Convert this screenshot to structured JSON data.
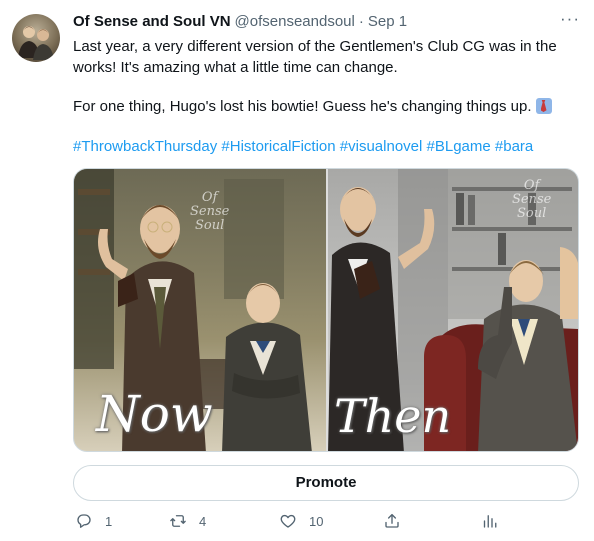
{
  "tweet": {
    "author_name": "Of Sense and Soul VN",
    "handle": "@ofsenseandsoul",
    "separator": "·",
    "date": "Sep 1",
    "more_label": "···",
    "text_line1": "Last year, a very different version of the Gentlemen's Club CG was in the works! It's amazing what a little time can change.",
    "text_line2": "For one thing, Hugo's lost his bowtie! Guess he's changing things up.",
    "emoji": "necktie-emoji",
    "hashtags": [
      "#ThrowbackThursday",
      "#HistoricalFiction",
      "#visualnovel",
      "#BLgame",
      "#bara"
    ]
  },
  "media": {
    "left_caption": "Now",
    "right_caption": "Then",
    "watermark_lines": [
      "Of",
      "Sense",
      "Soul"
    ]
  },
  "promote_label": "Promote",
  "actions": {
    "reply_count": "1",
    "retweet_count": "4",
    "like_count": "10",
    "icons": [
      "reply-icon",
      "retweet-icon",
      "like-icon",
      "share-icon",
      "analytics-icon"
    ]
  },
  "colors": {
    "link": "#1d9bf0",
    "secondary_text": "#536471",
    "primary_text": "#0f1419",
    "border": "#cfd9de"
  }
}
